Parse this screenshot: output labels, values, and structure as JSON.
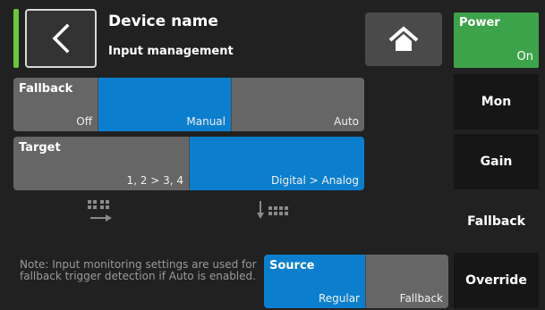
{
  "header": {
    "title": "Device name",
    "subtitle": "Input management",
    "back_icon": "chevron-left-icon",
    "home_icon": "home-icon",
    "status_color": "#69c73b"
  },
  "power": {
    "label": "Power",
    "value": "On",
    "color": "#3da34a"
  },
  "side_menu": [
    {
      "label": "Mon",
      "selected": false
    },
    {
      "label": "Gain",
      "selected": false
    },
    {
      "label": "Fallback",
      "selected": true
    },
    {
      "label": "Override",
      "selected": false
    }
  ],
  "fallback": {
    "label": "Fallback",
    "options": [
      "Off",
      "Manual",
      "Auto"
    ],
    "selected": "Manual"
  },
  "target": {
    "label": "Target",
    "options": [
      "1, 2 > 3, 4",
      "Digital > Analog"
    ],
    "selected": "Digital > Analog"
  },
  "source": {
    "label": "Source",
    "options": [
      "Regular",
      "Fallback"
    ],
    "selected": "Regular"
  },
  "icons": {
    "left": "digital-to-right-icon",
    "right": "down-to-analog-icon"
  },
  "note": "Note: Input monitoring settings are used for fallback trigger detection if Auto is enabled.",
  "colors": {
    "accent": "#0b7fce",
    "segment": "#666666",
    "background": "#212121"
  }
}
